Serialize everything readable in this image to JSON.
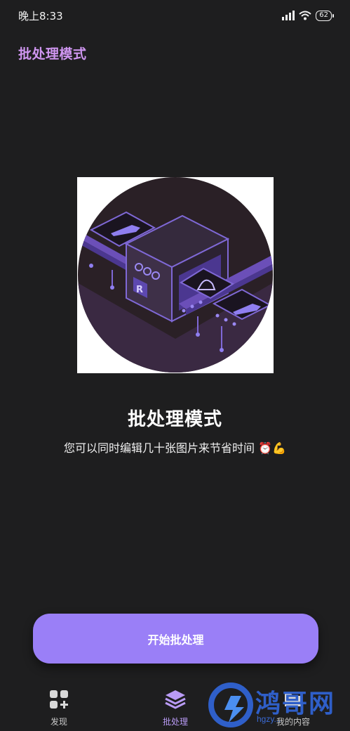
{
  "status_bar": {
    "time": "晚上8:33",
    "battery": "62"
  },
  "header": {
    "title": "批处理模式"
  },
  "hero": {
    "title": "批处理模式",
    "subtitle": "您可以同时编辑几十张图片来节省时间 ⏰💪"
  },
  "start_button": {
    "label": "开始批处理"
  },
  "bottom_nav": {
    "items": [
      {
        "label": "发现",
        "icon": "grid-plus-icon"
      },
      {
        "label": "批处理",
        "icon": "layers-icon",
        "active": true
      },
      {
        "label": "我的内容",
        "icon": "folder-icon"
      }
    ]
  },
  "watermark": {
    "brand": "鸿哥网",
    "domain": "hgzy..."
  },
  "colors": {
    "accent": "#9a7ff7",
    "title_purple": "#cf96f0",
    "background": "#1e1e1f"
  }
}
